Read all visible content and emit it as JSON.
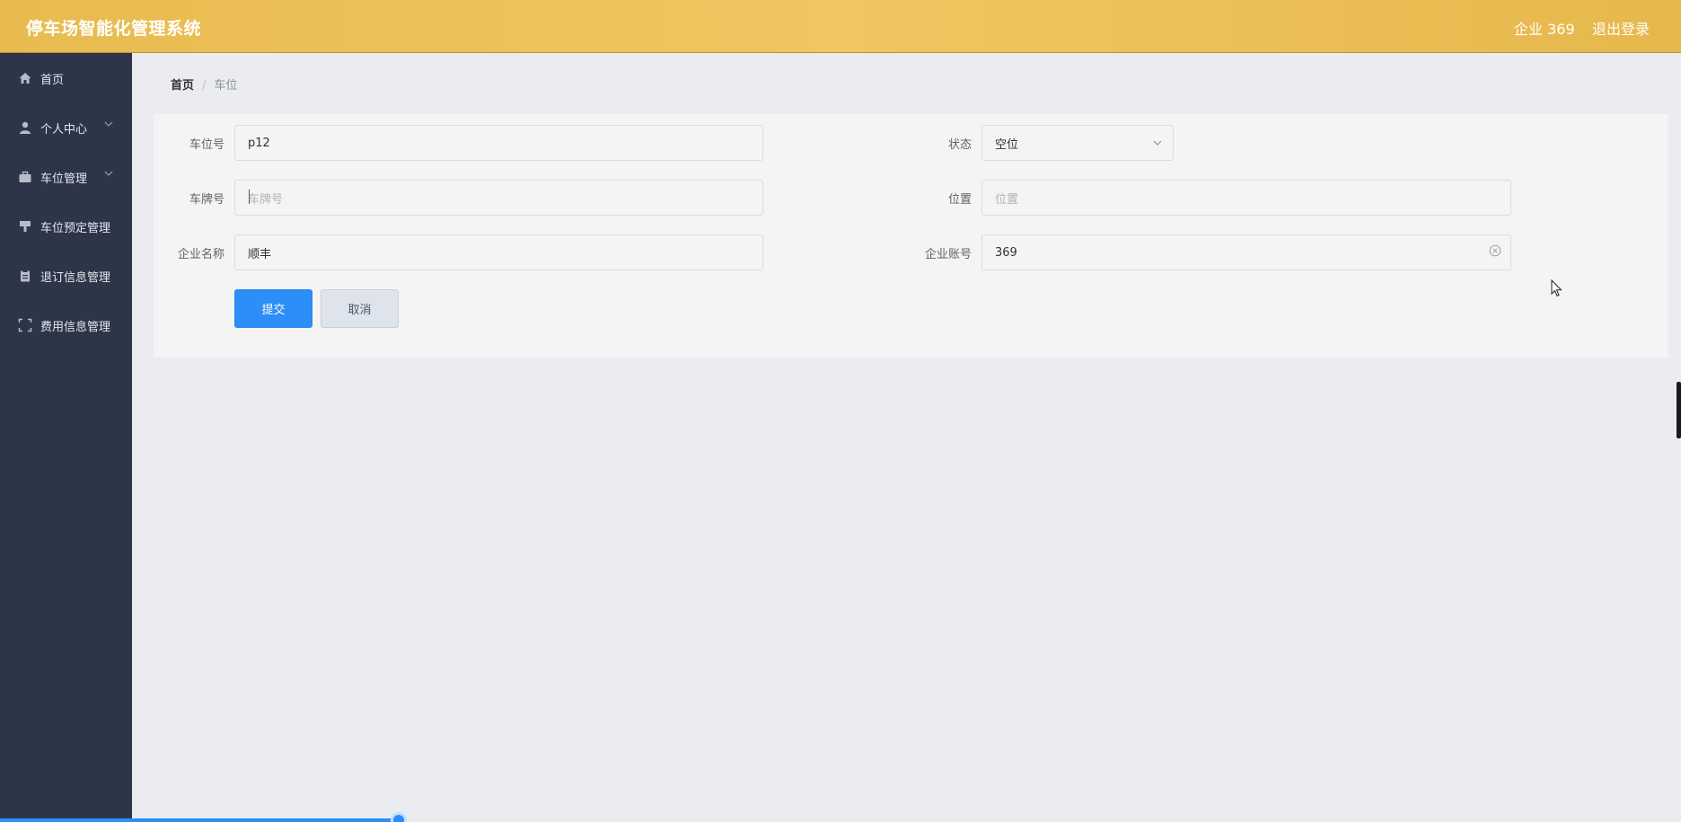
{
  "header": {
    "app_title": "停车场智能化管理系统",
    "user_label": "企业 369",
    "logout_label": "退出登录"
  },
  "sidebar": {
    "items": [
      {
        "label": "首页",
        "icon": "home-icon"
      },
      {
        "label": "个人中心",
        "icon": "user-icon"
      },
      {
        "label": "车位管理",
        "icon": "briefcase-icon"
      },
      {
        "label": "车位预定管理",
        "icon": "stamp-icon"
      },
      {
        "label": "退订信息管理",
        "icon": "clipboard-icon"
      },
      {
        "label": "费用信息管理",
        "icon": "fullscreen-icon"
      }
    ]
  },
  "breadcrumb": {
    "home": "首页",
    "separator": "/",
    "current": "车位"
  },
  "form": {
    "space_no": {
      "label": "车位号",
      "value": "p12"
    },
    "status": {
      "label": "状态",
      "value": "空位"
    },
    "plate_no": {
      "label": "车牌号",
      "placeholder": "车牌号"
    },
    "location": {
      "label": "位置",
      "placeholder": "位置"
    },
    "company_name": {
      "label": "企业名称",
      "value": "顺丰"
    },
    "company_account": {
      "label": "企业账号",
      "value": "369"
    },
    "submit_label": "提交",
    "cancel_label": "取消"
  },
  "colors": {
    "header_bg": "#ecc05a",
    "sidebar_bg": "#2d3549",
    "primary": "#2c8ef8"
  }
}
